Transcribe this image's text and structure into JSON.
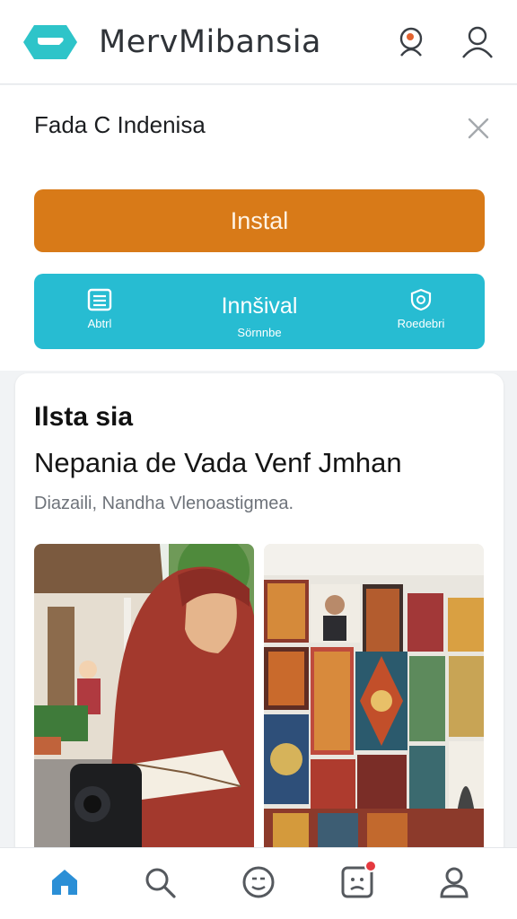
{
  "header": {
    "app_title": "MervMibansia",
    "logo_icon": "chat-bubble-logo-icon",
    "notification_icon": "bell-person-icon",
    "profile_icon": "user-icon"
  },
  "banner": {
    "title": "Fada C Indenisa",
    "install_label": "Instal",
    "teal_bar": {
      "center_label": "Innšival",
      "left_label": "Abtrl",
      "mid_label": "Sörnnbe",
      "right_label": "Roedebri"
    }
  },
  "card": {
    "heading": "Ilsta sia",
    "title": "Nepania de Vada Venf Jmhan",
    "subtitle": "Diazaili, Nandha Vlenoastigmea."
  },
  "colors": {
    "accent_orange": "#d87a18",
    "accent_teal": "#27bcd2",
    "nav_active": "#2b8fd6"
  },
  "bottom_nav": {
    "items": [
      "home-icon",
      "search-icon",
      "smiley-icon",
      "notification-icon",
      "profile-icon"
    ],
    "active": "home-icon"
  }
}
